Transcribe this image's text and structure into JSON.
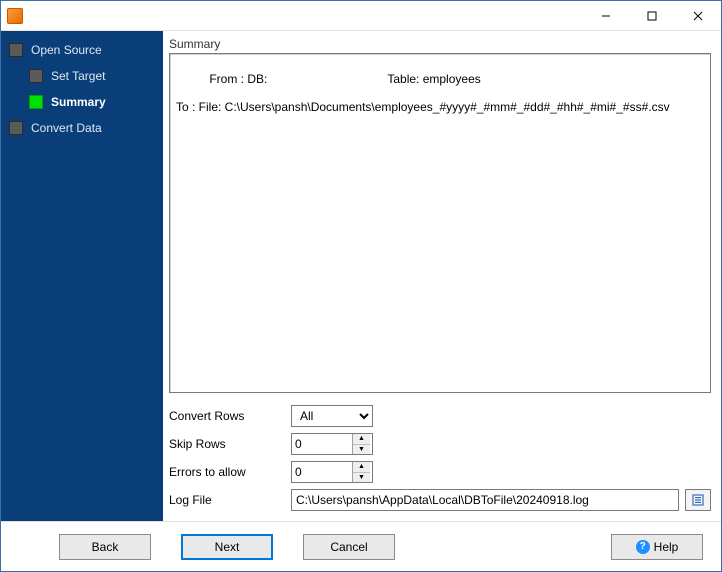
{
  "window": {
    "title": ""
  },
  "sidebar": {
    "items": [
      {
        "label": "Open Source",
        "active": false
      },
      {
        "label": "Set Target",
        "active": false
      },
      {
        "label": "Summary",
        "active": true
      },
      {
        "label": "Convert Data",
        "active": false
      }
    ]
  },
  "main": {
    "section_title": "Summary",
    "summary": {
      "from_label": "From : DB:",
      "table_label": "Table: employees",
      "to_line": "To : File: C:\\Users\\pansh\\Documents\\employees_#yyyy#_#mm#_#dd#_#hh#_#mi#_#ss#.csv"
    },
    "convert_rows": {
      "label": "Convert Rows",
      "value": "All"
    },
    "skip_rows": {
      "label": "Skip Rows",
      "value": "0"
    },
    "errors_allow": {
      "label": "Errors to allow",
      "value": "0"
    },
    "log_file": {
      "label": "Log File",
      "value": "C:\\Users\\pansh\\AppData\\Local\\DBToFile\\20240918.log"
    }
  },
  "buttons": {
    "back": "Back",
    "next": "Next",
    "cancel": "Cancel",
    "help": "Help"
  }
}
